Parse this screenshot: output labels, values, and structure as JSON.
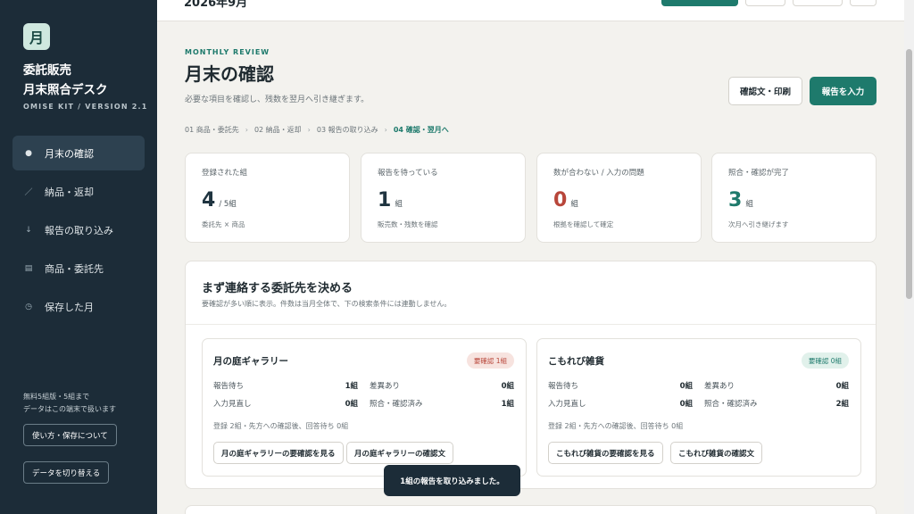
{
  "sidebar": {
    "logo_char": "月",
    "brand_line1": "委託販売",
    "brand_line2": "月末照合デスク",
    "version": "OMISE KIT / VERSION 2.1",
    "items": [
      {
        "label": "月末の確認",
        "icon": "●",
        "active": true
      },
      {
        "label": "納品・返却",
        "icon": "／"
      },
      {
        "label": "報告の取り込み",
        "icon": "↓"
      },
      {
        "label": "商品・委託先",
        "icon": "▤"
      },
      {
        "label": "保存した月",
        "icon": "◷"
      }
    ],
    "note_line1": "無料5組版・5組まで",
    "note_line2": "データはこの端末で扱います",
    "help_button": "使い方・保存について",
    "switch_button": "データを切り替える"
  },
  "topbar": {
    "title": "2026年9月"
  },
  "main": {
    "eyebrow": "MONTHLY REVIEW",
    "title": "月末の確認",
    "description": "必要な項目を確認し、残数を翌月へ引き継ぎます。",
    "btn_print": "確認文・印刷",
    "btn_enter": "報告を入力",
    "steps": [
      {
        "label": "01 商品・委託先"
      },
      {
        "label": "02 納品・返却"
      },
      {
        "label": "03 報告の取り込み"
      },
      {
        "label": "04 確認・翌月へ",
        "active": true
      }
    ],
    "step_sep": "›"
  },
  "stats": [
    {
      "label": "登録された組",
      "value": "4",
      "unit": "/ 5組",
      "sub": "委託先 × 商品"
    },
    {
      "label": "報告を待っている",
      "value": "1",
      "unit": "組",
      "sub": "販売数・残数を確認"
    },
    {
      "label": "数が合わない / 入力の問題",
      "value": "0",
      "unit": "組",
      "sub": "根拠を確認して確定"
    },
    {
      "label": "照合・確認が完了",
      "value": "3",
      "unit": "組",
      "sub": "次月へ引き継げます"
    }
  ],
  "panel": {
    "title": "まず連絡する委託先を決める",
    "description": "要確認が多い順に表示。件数は当月全体で、下の検索条件には連動しません。",
    "vendors": [
      {
        "name": "月の庭ギャラリー",
        "badge": "要確認 1組",
        "rows": [
          {
            "label": "報告待ち",
            "value": "1組"
          },
          {
            "label": "差異あり",
            "value": "0組"
          },
          {
            "label": "入力見直し",
            "value": "0組"
          },
          {
            "label": "照合・確認済み",
            "value": "1組"
          }
        ],
        "note": "登録 2組・先方への確認後、回答待ち 0組",
        "btn_view": "月の庭ギャラリーの要確認を見る",
        "btn_confirm": "月の庭ギャラリーの確認文"
      },
      {
        "name": "こもれび雑貨",
        "badge": "要確認 0組",
        "rows": [
          {
            "label": "報告待ち",
            "value": "0組"
          },
          {
            "label": "差異あり",
            "value": "0組"
          },
          {
            "label": "入力見直し",
            "value": "0組"
          },
          {
            "label": "照合・確認済み",
            "value": "2組"
          }
        ],
        "note": "登録 2組・先方への確認後、回答待ち 0組",
        "btn_view": "こもれび雑貨の要確認を見る",
        "btn_confirm": "こもれび雑貨の確認文"
      }
    ]
  },
  "toast": {
    "message": "1組の報告を取り込みました。"
  },
  "colors": {
    "accent": "#1e7a6c",
    "sidebar": "#1c2c38",
    "danger": "#b8463a"
  }
}
